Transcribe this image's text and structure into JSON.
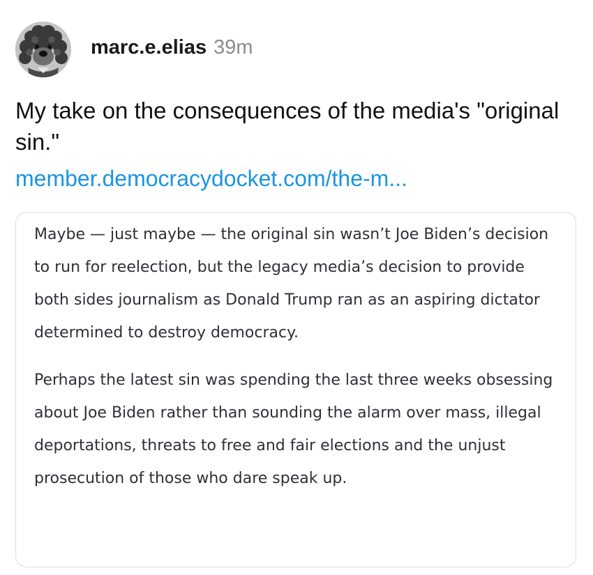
{
  "post": {
    "author": "marc.e.elias",
    "timestamp": "39m",
    "avatar_icon": "dog-avatar",
    "text": "My take on the consequences of the media's \"original sin.\"",
    "link_text": "member.democracydocket.com/the-m..."
  },
  "quote": {
    "paragraphs": [
      "Maybe — just maybe — the original sin wasn’t Joe Biden’s decision to run for reelection, but the legacy media’s decision to provide both sides journalism as Donald Trump ran as an aspiring dictator determined to destroy democracy.",
      "Perhaps the latest sin was spending the last three weeks obsessing about Joe Biden rather than sounding the alarm over mass, illegal deportations, threats to free and fair elections and the unjust prosecution of those who dare speak up."
    ]
  },
  "colors": {
    "link": "#1b95e0",
    "timestamp": "#8c8c8c",
    "quote_text": "#2e3035",
    "card_border": "#dddddd"
  }
}
